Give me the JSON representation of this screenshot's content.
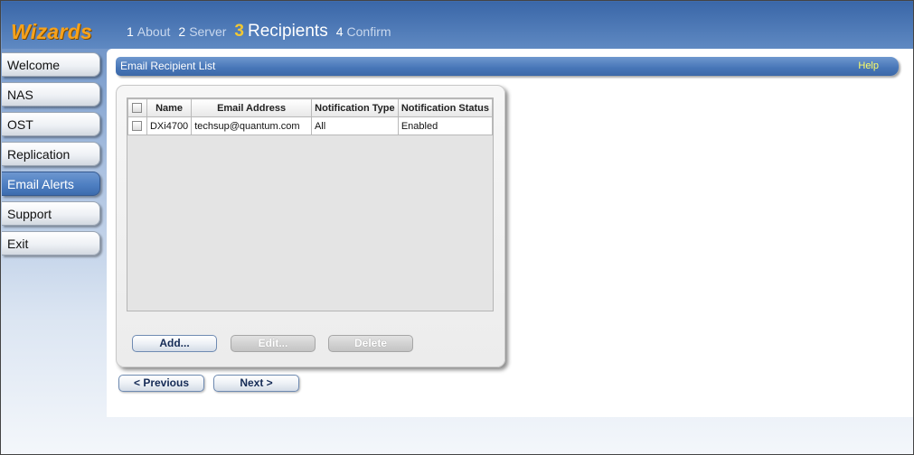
{
  "header": {
    "logo": "Wizards",
    "steps": [
      {
        "num": "1",
        "label": "About"
      },
      {
        "num": "2",
        "label": "Server"
      },
      {
        "num": "3",
        "label": "Recipients"
      },
      {
        "num": "4",
        "label": "Confirm"
      }
    ],
    "current_step": "3"
  },
  "sidebar": {
    "items": [
      {
        "label": "Welcome"
      },
      {
        "label": "NAS"
      },
      {
        "label": "OST"
      },
      {
        "label": "Replication"
      },
      {
        "label": "Email Alerts"
      },
      {
        "label": "Support"
      },
      {
        "label": "Exit"
      }
    ],
    "active": "Email Alerts"
  },
  "panel": {
    "title": "Email Recipient List",
    "help": "Help"
  },
  "table": {
    "columns": [
      "Name",
      "Email Address",
      "Notification Type",
      "Notification Status"
    ],
    "rows": [
      {
        "name": "DXi4700",
        "email": "techsup@quantum.com",
        "type": "All",
        "status": "Enabled",
        "checked": false
      }
    ]
  },
  "actions": {
    "add": "Add...",
    "edit": "Edit...",
    "delete": "Delete"
  },
  "nav": {
    "previous": "< Previous",
    "next": "Next >"
  },
  "colors": {
    "header_blue": "#3a67a8",
    "logo_orange": "#f7a21b",
    "active_nav": "#4e7fc2",
    "help_yellow": "#ffff66"
  }
}
